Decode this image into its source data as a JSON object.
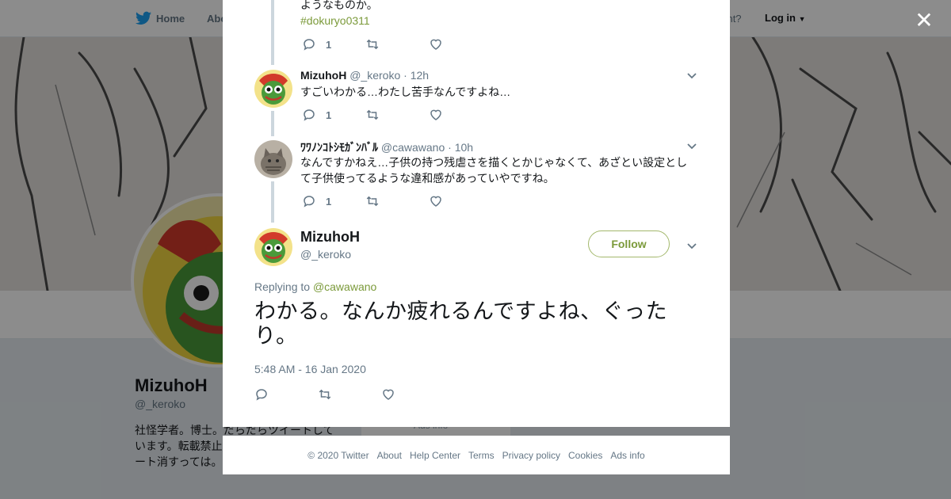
{
  "background": {
    "nav": {
      "home": "Home",
      "about": "Abo",
      "account_prompt": "ccount?",
      "login": "Log in"
    },
    "profile": {
      "name": "MizuhoH",
      "handle": "@_keroko",
      "bio": "社怪学者。博士。だらだらツイートしています。転載禁止たち」(青弓社)アらツイート消すっては。",
      "card_text": "Ads info"
    }
  },
  "close_icon": "close-icon",
  "thread": [
    {
      "text_tail": "ようなものか。",
      "hashtag": "#dokuryo0311",
      "reply_count": "1"
    },
    {
      "name": "MizuhoH",
      "handle": "@_keroko",
      "time": "· 12h",
      "text": "すごいわかる…わたし苦手なんですよね…",
      "reply_count": "1"
    },
    {
      "name": "ﾜﾜﾉﾝｺﾄｼﾓｶﾞﾝﾊﾞﾙ",
      "handle": "@cawawano",
      "time": "· 10h",
      "text": "なんですかねえ…子供の持つ残虐さを描くとかじゃなくて、あざとい設定として子供使ってるような違和感があっていやですね。",
      "reply_count": "1"
    }
  ],
  "main_tweet": {
    "name": "MizuhoH",
    "handle": "@_keroko",
    "follow_label": "Follow",
    "replying_label": "Replying to",
    "replying_to": "@cawawano",
    "text": "わかる。なんか疲れるんですよね、ぐったり。",
    "timestamp": "5:48 AM - 16 Jan 2020"
  },
  "footer": {
    "copyright": "© 2020 Twitter",
    "links": [
      "About",
      "Help Center",
      "Terms",
      "Privacy policy",
      "Cookies",
      "Ads info"
    ]
  },
  "colors": {
    "accent": "#7b9a3a",
    "follow_border": "#a3b86c",
    "muted": "#657786",
    "text": "#14171a"
  }
}
